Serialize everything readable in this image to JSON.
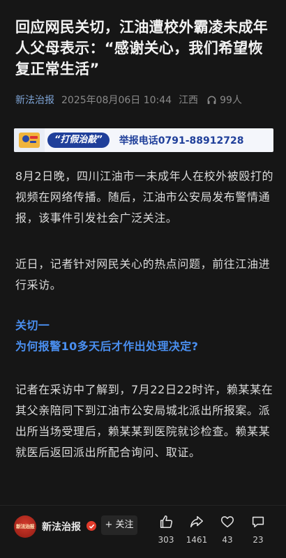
{
  "article": {
    "title": "回应网民关切，江油遭校外霸凌未成年人父母表示：“感谢关心，我们希望恢复正常生活”",
    "source": "新法治报",
    "datetime": "2025年08月06日 10:44",
    "location": "江西",
    "listen_count": "99人",
    "banner": {
      "slogan": "“打假治敲”",
      "hotline": "举报电话0791-88912728"
    },
    "paragraphs": [
      "8月2日晚，四川江油市一未成年人在校外被殴打的视频在网络传播。随后，江油市公安局发布警情通报，该事件引发社会广泛关注。",
      "近日，记者针对网民关心的热点问题，前往江油进行采访。",
      "记者在采访中了解到，7月22日22时许，赖某某在其父亲陪同下到江油市公安局城北派出所报案。派出所当场受理后，赖某某到医院就诊检查。赖某某就医后返回派出所配合询问、取证。"
    ],
    "subheads": [
      "关切一",
      "为何报警10多天后才作出处理决定?"
    ]
  },
  "bottom_bar": {
    "account_name": "新法治报",
    "avatar_text": "新法治报",
    "follow_label": "+ 关注",
    "likes": "303",
    "shares": "1461",
    "favorites": "43",
    "comments": "23"
  },
  "colors": {
    "background": "#161616",
    "accent_blue": "#4a8ff0",
    "source_blue": "#7ea4d6",
    "verified_red": "#e13b2b"
  },
  "icons": [
    "headphones-icon",
    "thumbs-up-icon",
    "share-icon",
    "heart-icon",
    "comment-icon",
    "verified-icon"
  ]
}
